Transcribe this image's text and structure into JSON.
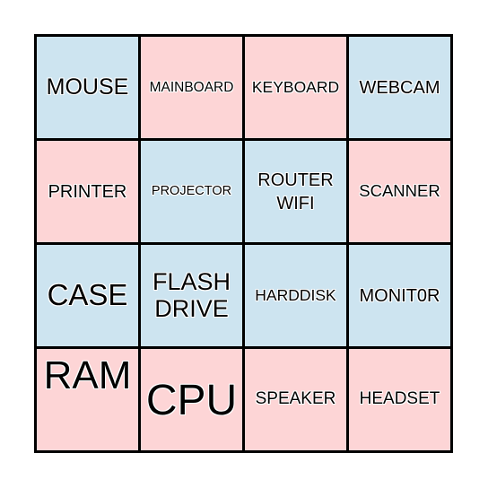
{
  "board": {
    "colors": {
      "blue": "#cde4f0",
      "pink": "#fdd5d6",
      "grid": "#000000"
    },
    "cells": [
      {
        "label": "MOUSE",
        "color": "blue"
      },
      {
        "label": "MAINBOARD",
        "color": "pink"
      },
      {
        "label": "KEYBOARD",
        "color": "pink"
      },
      {
        "label": "WEBCAM",
        "color": "blue"
      },
      {
        "label": "PRINTER",
        "color": "pink"
      },
      {
        "label": "PROJECTOR",
        "color": "blue"
      },
      {
        "label": "ROUTER\nWIFI",
        "color": "blue"
      },
      {
        "label": "SCANNER",
        "color": "pink"
      },
      {
        "label": "CASE",
        "color": "blue"
      },
      {
        "label": "FLASH\nDRIVE",
        "color": "blue"
      },
      {
        "label": "HARDDISK",
        "color": "blue"
      },
      {
        "label": "MONIT0R",
        "color": "blue"
      },
      {
        "label": "RAM",
        "color": "pink"
      },
      {
        "label": "CPU",
        "color": "pink"
      },
      {
        "label": "SPEAKER",
        "color": "pink"
      },
      {
        "label": "HEADSET",
        "color": "pink"
      }
    ]
  }
}
